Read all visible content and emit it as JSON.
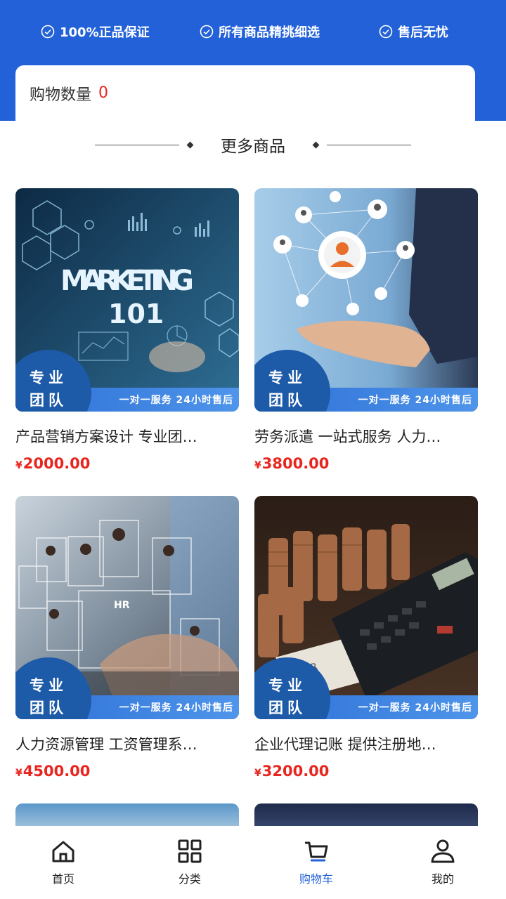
{
  "header": {
    "guarantees": [
      "100%正品保证",
      "所有商品精挑细选",
      "售后无忧"
    ]
  },
  "cart": {
    "label": "购物数量",
    "count": "0"
  },
  "section": {
    "title": "更多商品"
  },
  "products": [
    {
      "title": "产品营销方案设计 专业团…",
      "price": "2000.00",
      "badge_top": "专业",
      "badge_bottom": "团队",
      "strip": "一对一服务 24小时售后",
      "image": "marketing-101-image"
    },
    {
      "title": "劳务派遣 一站式服务 人力…",
      "price": "3800.00",
      "badge_top": "专业",
      "badge_bottom": "团队",
      "strip": "一对一服务 24小时售后",
      "image": "network-hand-image"
    },
    {
      "title": "人力资源管理 工资管理系…",
      "price": "4500.00",
      "badge_top": "专业",
      "badge_bottom": "团队",
      "strip": "一对一服务 24小时售后",
      "image": "hr-resumes-image"
    },
    {
      "title": "企业代理记账 提供注册地…",
      "price": "3200.00",
      "badge_top": "专业",
      "badge_bottom": "团队",
      "strip": "一对一服务 24小时售后",
      "image": "coins-calculator-image"
    }
  ],
  "currency": "¥",
  "tabbar": [
    {
      "label": "首页",
      "icon": "home-icon"
    },
    {
      "label": "分类",
      "icon": "grid-icon"
    },
    {
      "label": "购物车",
      "icon": "cart-icon",
      "active": true
    },
    {
      "label": "我的",
      "icon": "user-icon"
    }
  ],
  "colors": {
    "brand": "#2261d8",
    "price": "#e8261f",
    "badge": "#1d5aa8"
  }
}
